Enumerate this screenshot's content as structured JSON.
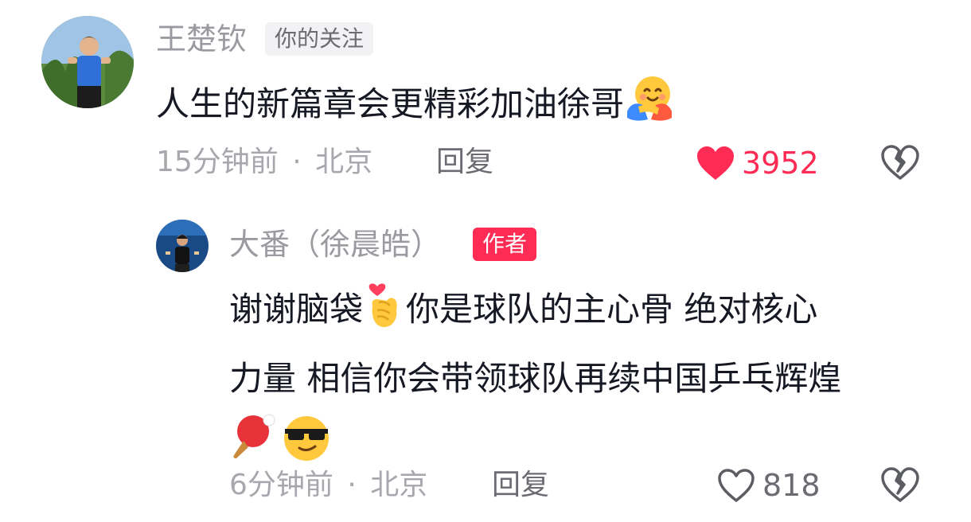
{
  "comments": [
    {
      "username": "王楚钦",
      "badge": "你的关注",
      "text": "人生的新篇章会更精彩加油徐哥",
      "emoji": "hugging-face",
      "time": "15分钟前",
      "location": "北京",
      "separator": "·",
      "reply_label": "回复",
      "likes": "3952",
      "liked": true
    },
    {
      "username": "大番（徐晨皓）",
      "badge": "作者",
      "text_line1": "谢谢脑袋",
      "text_line1b": "你是球队的主心骨 绝对核心",
      "text_line2": "力量 相信你会带领球队再续中国乒乓辉煌",
      "emojis": [
        "finger-heart",
        "ping-pong",
        "sunglasses-face"
      ],
      "time": "6分钟前",
      "location": "北京",
      "separator": "·",
      "reply_label": "回复",
      "likes": "818",
      "liked": false
    }
  ],
  "colors": {
    "accent": "#fe2c55",
    "muted": "#a7a8ad",
    "text": "#161823"
  }
}
